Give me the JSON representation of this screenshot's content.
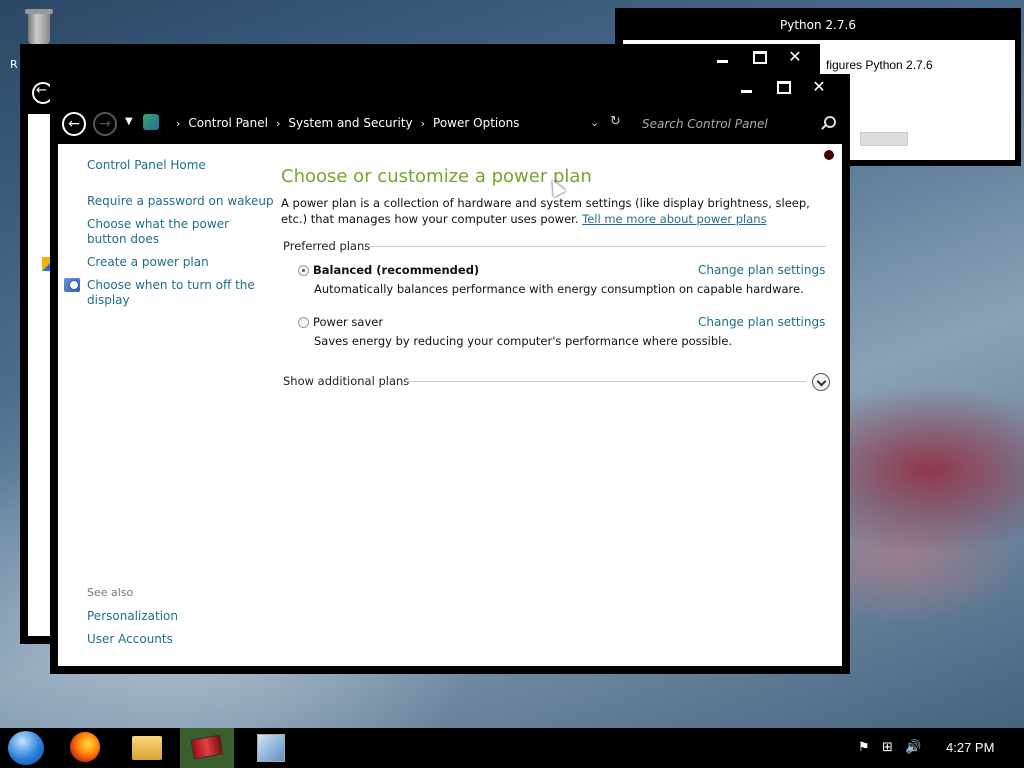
{
  "desktop": {
    "recycle_bin_label": "R"
  },
  "python_dialog": {
    "title": "Python 2.7.6",
    "text": "figures Python 2.7.6"
  },
  "window": {
    "breadcrumbs": [
      "Control Panel",
      "System and Security",
      "Power Options"
    ],
    "search_placeholder": "Search Control Panel"
  },
  "sidebar": {
    "home": "Control Panel Home",
    "links": [
      "Require a password on wakeup",
      "Choose what the power button does",
      "Create a power plan",
      "Choose when to turn off the display"
    ],
    "see_also_heading": "See also",
    "see_also_links": [
      "Personalization",
      "User Accounts"
    ]
  },
  "main": {
    "title": "Choose or customize a power plan",
    "description": "A power plan is a collection of hardware and system settings (like display brightness, sleep, etc.) that manages how your computer uses power.",
    "description_link": "Tell me more about power plans",
    "preferred_plans_label": "Preferred plans",
    "plans": [
      {
        "name": "Balanced (recommended)",
        "description": "Automatically balances performance with energy consumption on capable hardware.",
        "selected": true,
        "link": "Change plan settings"
      },
      {
        "name": "Power saver",
        "description": "Saves energy by reducing your computer's performance where possible.",
        "selected": false,
        "link": "Change plan settings"
      }
    ],
    "show_additional": "Show additional plans"
  },
  "taskbar": {
    "apps": [
      "firefox-icon",
      "file-explorer-icon",
      "power-app-icon",
      "installer-icon"
    ],
    "clock": "4:27 PM"
  },
  "colors": {
    "title_green": "#7aa32c",
    "link_teal": "#1e6f87",
    "chrome": "#000000"
  }
}
